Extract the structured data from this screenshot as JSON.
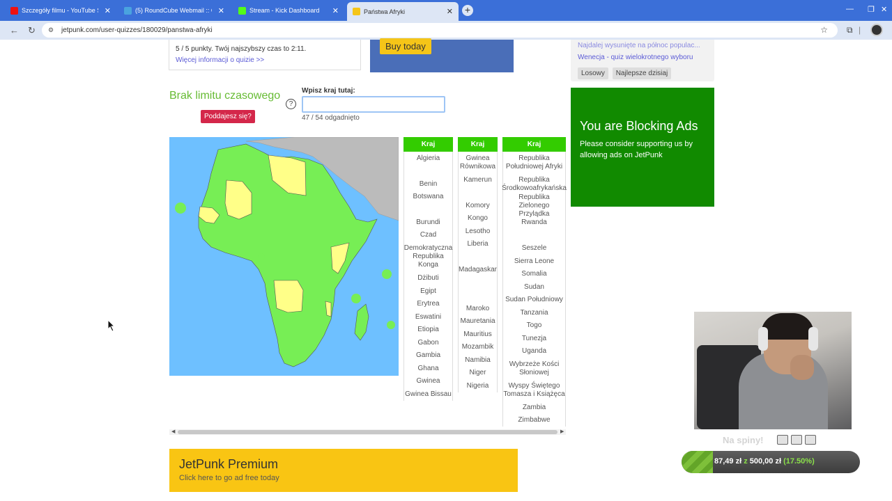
{
  "browser": {
    "tabs": [
      {
        "label": "Szczegóły filmu - YouTube Studio",
        "icon": "youtube-icon",
        "color": "#e11"
      },
      {
        "label": "(5) RoundCube Webmail :: Odebrane",
        "icon": "roundcube-icon",
        "color": "#4aa3df"
      },
      {
        "label": "Stream - Kick Dashboard",
        "icon": "kick-icon",
        "color": "#53fc18"
      },
      {
        "label": "Państwa Afryki",
        "icon": "jetpunk-icon",
        "color": "#f5c518"
      }
    ],
    "url": "jetpunk.com/user-quizzes/180029/panstwa-afryki"
  },
  "info": {
    "points": "5 / 5 punkty. Twój najszybszy czas to 2:11.",
    "more_link": "Więcej informacji o quizie >>"
  },
  "ad_top": {
    "buy": "Buy today"
  },
  "sidebar": {
    "links": [
      "Najdalej wysunięte na północ populac...",
      "Wenecja - quiz wielokrotnego wyboru"
    ],
    "random": "Losowy",
    "best_today": "Najlepsze dzisiaj"
  },
  "quiz": {
    "title": "Brak limitu czasowego",
    "give_up": "Poddajesz się?",
    "help": "?",
    "input_label": "Wpisz kraj tutaj:",
    "input_value": "",
    "counter": "47 / 54 odgadnięto",
    "header": "Kraj"
  },
  "table": {
    "col1": [
      {
        "t": "Algieria",
        "h": 19
      },
      {
        "t": "",
        "h": 18
      },
      {
        "t": "Benin",
        "h": 19
      },
      {
        "t": "Botswana",
        "h": 18
      },
      {
        "t": "",
        "h": 18
      },
      {
        "t": "Burundi",
        "h": 19
      },
      {
        "t": "Czad",
        "h": 18
      },
      {
        "t": "Demokratyczna Republika Konga",
        "h": 44
      },
      {
        "t": "Dżibuti",
        "h": 18
      },
      {
        "t": "Egipt",
        "h": 19
      },
      {
        "t": "Erytrea",
        "h": 18
      },
      {
        "t": "Eswatini",
        "h": 19
      },
      {
        "t": "Etiopia",
        "h": 18
      },
      {
        "t": "Gabon",
        "h": 19
      },
      {
        "t": "Gambia",
        "h": 18
      },
      {
        "t": "Ghana",
        "h": 19
      },
      {
        "t": "Gwinea",
        "h": 18
      },
      {
        "t": "Gwinea Bissau",
        "h": 19
      }
    ],
    "col2": [
      {
        "t": "Gwinea Równikowa",
        "h": 31
      },
      {
        "t": "Kamerun",
        "h": 19
      },
      {
        "t": "",
        "h": 18
      },
      {
        "t": "Komory",
        "h": 19
      },
      {
        "t": "Kongo",
        "h": 18
      },
      {
        "t": "Lesotho",
        "h": 19
      },
      {
        "t": "Liberia",
        "h": 18
      },
      {
        "t": "",
        "h": 19
      },
      {
        "t": "Madagaskar",
        "h": 18
      },
      {
        "t": "",
        "h": 19
      },
      {
        "t": "",
        "h": 18
      },
      {
        "t": "Maroko",
        "h": 19
      },
      {
        "t": "Mauretania",
        "h": 18
      },
      {
        "t": "Mauritius",
        "h": 19
      },
      {
        "t": "Mozambik",
        "h": 18
      },
      {
        "t": "Namibia",
        "h": 19
      },
      {
        "t": "Niger",
        "h": 18
      },
      {
        "t": "Nigeria",
        "h": 19
      }
    ],
    "col3": [
      {
        "t": "Republika Południowej Afryki",
        "h": 31
      },
      {
        "t": "Republika Środkowoafrykańska",
        "h": 31
      },
      {
        "t": "Republika Zielonego Przylądka",
        "h": 31
      },
      {
        "t": "Rwanda",
        "h": 18
      },
      {
        "t": "",
        "h": 19
      },
      {
        "t": "Seszele",
        "h": 18
      },
      {
        "t": "Sierra Leone",
        "h": 19
      },
      {
        "t": "Somalia",
        "h": 18
      },
      {
        "t": "Sudan",
        "h": 19
      },
      {
        "t": "Sudan Południowy",
        "h": 18
      },
      {
        "t": "Tanzania",
        "h": 19
      },
      {
        "t": "Togo",
        "h": 18
      },
      {
        "t": "Tunezja",
        "h": 19
      },
      {
        "t": "Uganda",
        "h": 18
      },
      {
        "t": "Wybrzeże Kości Słoniowej",
        "h": 31
      },
      {
        "t": "Wyspy Świętego Tomasza i Książęca",
        "h": 31
      },
      {
        "t": "Zambia",
        "h": 19
      },
      {
        "t": "Zimbabwe",
        "h": 18
      }
    ]
  },
  "blocking": {
    "title": "You are Blocking Ads",
    "text": "Please consider supporting us by allowing ads on JetPunk"
  },
  "premium": {
    "title": "JetPunk Premium",
    "text": "Click here to go ad free today"
  },
  "overlay": {
    "goal_title": "Na spiny!",
    "goal_current": "87,49 zł",
    "goal_sep": "z",
    "goal_total": "500,00 zł",
    "goal_pct": "(17.50%)",
    "goal_fraction": 0.175
  },
  "colors": {
    "green": "#33cc00",
    "map_land": "#77ee55",
    "map_missing": "#ffff88",
    "map_sea": "#6ec0ff"
  }
}
